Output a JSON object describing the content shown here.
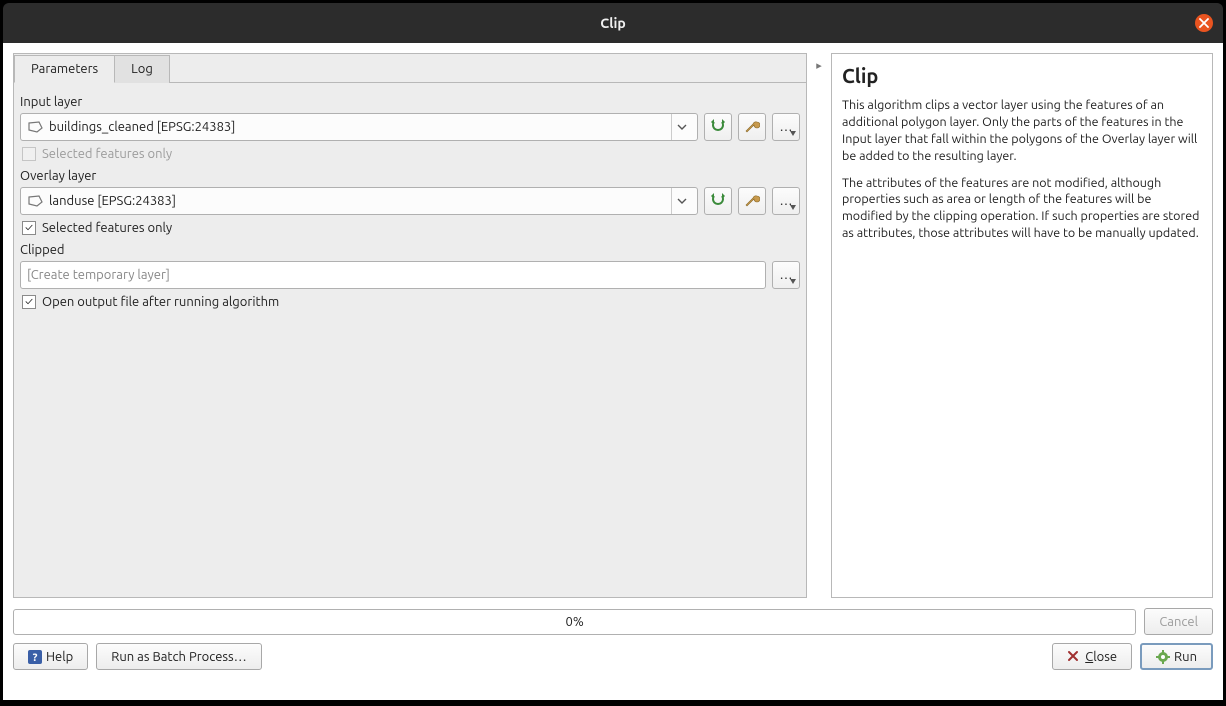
{
  "window": {
    "title": "Clip"
  },
  "tabs": {
    "parameters": "Parameters",
    "log": "Log"
  },
  "params": {
    "input_layer_label": "Input layer",
    "input_layer_value": "buildings_cleaned [EPSG:24383]",
    "input_selected_only_label": "Selected features only",
    "input_selected_only_checked": false,
    "overlay_layer_label": "Overlay layer",
    "overlay_layer_value": "landuse [EPSG:24383]",
    "overlay_selected_only_label": "Selected features only",
    "overlay_selected_only_checked": true,
    "clipped_label": "Clipped",
    "clipped_placeholder": "[Create temporary layer]",
    "open_output_label": "Open output file after running algorithm",
    "open_output_checked": true
  },
  "help": {
    "title": "Clip",
    "p1": "This algorithm clips a vector layer using the features of an additional polygon layer. Only the parts of the features in the Input layer that fall within the polygons of the Overlay layer will be added to the resulting layer.",
    "p2": "The attributes of the features are not modified, although properties such as area or length of the features will be modified by the clipping operation. If such properties are stored as attributes, those attributes will have to be manually updated."
  },
  "progress": {
    "percent": "0%"
  },
  "buttons": {
    "cancel": "Cancel",
    "help": "Help",
    "batch": "Run as Batch Process…",
    "close": "Close",
    "run": "Run"
  },
  "icons": {
    "reload": "reload-icon",
    "wrench": "wrench-icon",
    "more": "more-icon",
    "polygon": "polygon-layer-icon"
  }
}
